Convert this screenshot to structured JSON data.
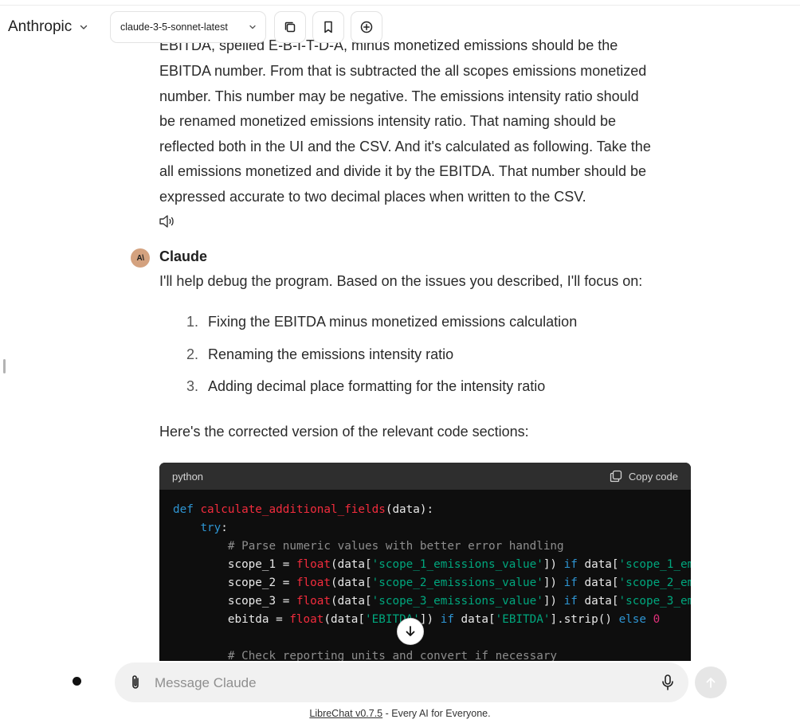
{
  "header": {
    "brand": "Anthropic",
    "model": "claude-3-5-sonnet-latest",
    "icons": [
      "chevron-down-icon",
      "copy-icon",
      "bookmark-icon",
      "new-chat-icon"
    ]
  },
  "user_message": {
    "partial_top_line": "EBITDA, spelled E-B-I-T-D-A, minus monetized emissions should be the",
    "lines": [
      "EBITDA number. From that is subtracted the all scopes emissions monetized",
      "number. This number may be negative. The emissions intensity ratio should",
      "be renamed monetized emissions intensity ratio. That naming should be",
      "reflected both in the UI and the CSV. And it's calculated as following. Take the",
      "all emissions monetized and divide it by the EBITDA. That number should be",
      "expressed accurate to two decimal places when written to the CSV."
    ]
  },
  "assistant": {
    "avatar_text": "A\\",
    "name": "Claude",
    "intro": "I'll help debug the program. Based on the issues you described, I'll focus on:",
    "list": [
      {
        "num": "1.",
        "text": "Fixing the EBITDA minus monetized emissions calculation"
      },
      {
        "num": "2.",
        "text": "Renaming the emissions intensity ratio"
      },
      {
        "num": "3.",
        "text": "Adding decimal place formatting for the intensity ratio"
      }
    ],
    "after_list": "Here's the corrected version of the relevant code sections:"
  },
  "code_block": {
    "language": "python",
    "copy_label": "Copy code"
  },
  "composer": {
    "placeholder": "Message Claude"
  },
  "footer": {
    "link": "LibreChat v0.7.5",
    "text": " - Every AI for Everyone."
  },
  "colors": {
    "code_bg": "#0e0e0e",
    "code_header": "#2e2e2e",
    "avatar": "#d4a27f",
    "keyword": "#2e95d3",
    "function": "#f22c3d",
    "string": "#00a67d",
    "comment": "#8d8d8d"
  }
}
